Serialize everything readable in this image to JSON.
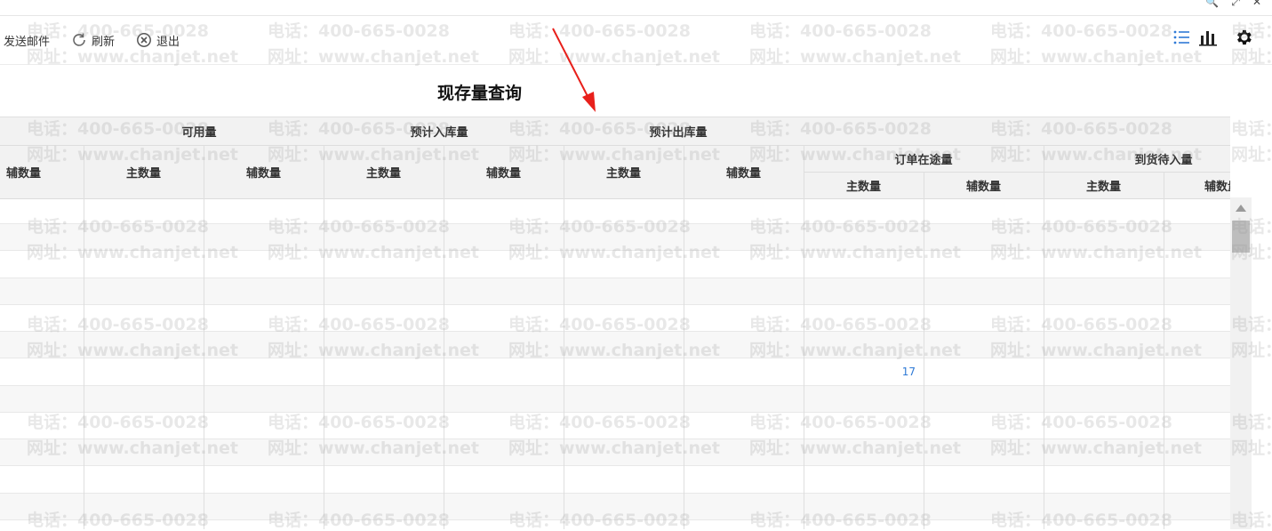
{
  "window_controls": [
    "🔍",
    "⤢",
    "✕"
  ],
  "toolbar": {
    "send_mail": "发送邮件",
    "refresh": "刷新",
    "exit": "退出"
  },
  "page_title": "现存量查询",
  "table": {
    "group_headers": {
      "available": "可用量",
      "expected_in": "预计入库量",
      "expected_out": "预计出库量",
      "order_transit": "订单在途量",
      "arrival_pending": "到货待入量"
    },
    "sub_headers": {
      "aux": "辅数量",
      "main": "主数量"
    },
    "cell_value": "17"
  },
  "watermark": {
    "phone": "电话：400-665-0028",
    "site": "网址：www.chanjet.net"
  },
  "accent_color": "#2f7ad6"
}
